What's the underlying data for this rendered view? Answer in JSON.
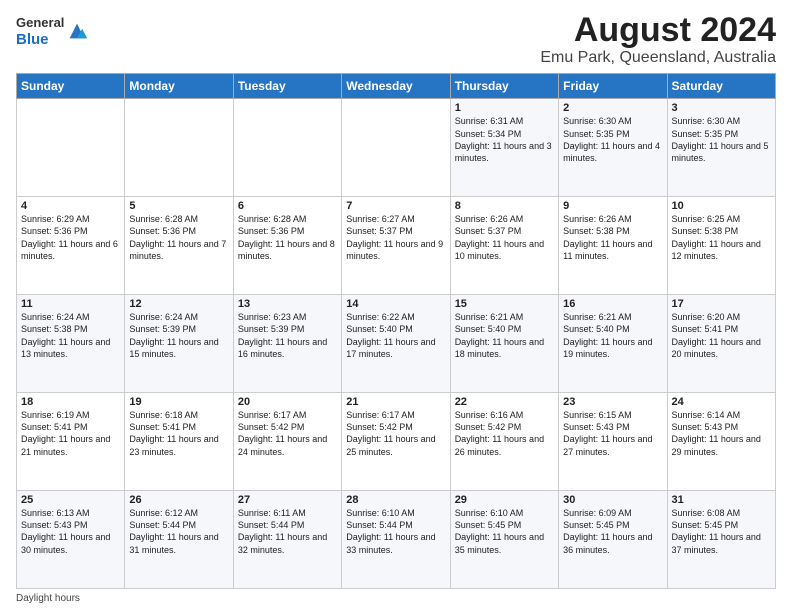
{
  "logo": {
    "general": "General",
    "blue": "Blue"
  },
  "title": "August 2024",
  "subtitle": "Emu Park, Queensland, Australia",
  "header_days": [
    "Sunday",
    "Monday",
    "Tuesday",
    "Wednesday",
    "Thursday",
    "Friday",
    "Saturday"
  ],
  "weeks": [
    [
      {
        "day": "",
        "info": ""
      },
      {
        "day": "",
        "info": ""
      },
      {
        "day": "",
        "info": ""
      },
      {
        "day": "",
        "info": ""
      },
      {
        "day": "1",
        "info": "Sunrise: 6:31 AM\nSunset: 5:34 PM\nDaylight: 11 hours and 3 minutes."
      },
      {
        "day": "2",
        "info": "Sunrise: 6:30 AM\nSunset: 5:35 PM\nDaylight: 11 hours and 4 minutes."
      },
      {
        "day": "3",
        "info": "Sunrise: 6:30 AM\nSunset: 5:35 PM\nDaylight: 11 hours and 5 minutes."
      }
    ],
    [
      {
        "day": "4",
        "info": "Sunrise: 6:29 AM\nSunset: 5:36 PM\nDaylight: 11 hours and 6 minutes."
      },
      {
        "day": "5",
        "info": "Sunrise: 6:28 AM\nSunset: 5:36 PM\nDaylight: 11 hours and 7 minutes."
      },
      {
        "day": "6",
        "info": "Sunrise: 6:28 AM\nSunset: 5:36 PM\nDaylight: 11 hours and 8 minutes."
      },
      {
        "day": "7",
        "info": "Sunrise: 6:27 AM\nSunset: 5:37 PM\nDaylight: 11 hours and 9 minutes."
      },
      {
        "day": "8",
        "info": "Sunrise: 6:26 AM\nSunset: 5:37 PM\nDaylight: 11 hours and 10 minutes."
      },
      {
        "day": "9",
        "info": "Sunrise: 6:26 AM\nSunset: 5:38 PM\nDaylight: 11 hours and 11 minutes."
      },
      {
        "day": "10",
        "info": "Sunrise: 6:25 AM\nSunset: 5:38 PM\nDaylight: 11 hours and 12 minutes."
      }
    ],
    [
      {
        "day": "11",
        "info": "Sunrise: 6:24 AM\nSunset: 5:38 PM\nDaylight: 11 hours and 13 minutes."
      },
      {
        "day": "12",
        "info": "Sunrise: 6:24 AM\nSunset: 5:39 PM\nDaylight: 11 hours and 15 minutes."
      },
      {
        "day": "13",
        "info": "Sunrise: 6:23 AM\nSunset: 5:39 PM\nDaylight: 11 hours and 16 minutes."
      },
      {
        "day": "14",
        "info": "Sunrise: 6:22 AM\nSunset: 5:40 PM\nDaylight: 11 hours and 17 minutes."
      },
      {
        "day": "15",
        "info": "Sunrise: 6:21 AM\nSunset: 5:40 PM\nDaylight: 11 hours and 18 minutes."
      },
      {
        "day": "16",
        "info": "Sunrise: 6:21 AM\nSunset: 5:40 PM\nDaylight: 11 hours and 19 minutes."
      },
      {
        "day": "17",
        "info": "Sunrise: 6:20 AM\nSunset: 5:41 PM\nDaylight: 11 hours and 20 minutes."
      }
    ],
    [
      {
        "day": "18",
        "info": "Sunrise: 6:19 AM\nSunset: 5:41 PM\nDaylight: 11 hours and 21 minutes."
      },
      {
        "day": "19",
        "info": "Sunrise: 6:18 AM\nSunset: 5:41 PM\nDaylight: 11 hours and 23 minutes."
      },
      {
        "day": "20",
        "info": "Sunrise: 6:17 AM\nSunset: 5:42 PM\nDaylight: 11 hours and 24 minutes."
      },
      {
        "day": "21",
        "info": "Sunrise: 6:17 AM\nSunset: 5:42 PM\nDaylight: 11 hours and 25 minutes."
      },
      {
        "day": "22",
        "info": "Sunrise: 6:16 AM\nSunset: 5:42 PM\nDaylight: 11 hours and 26 minutes."
      },
      {
        "day": "23",
        "info": "Sunrise: 6:15 AM\nSunset: 5:43 PM\nDaylight: 11 hours and 27 minutes."
      },
      {
        "day": "24",
        "info": "Sunrise: 6:14 AM\nSunset: 5:43 PM\nDaylight: 11 hours and 29 minutes."
      }
    ],
    [
      {
        "day": "25",
        "info": "Sunrise: 6:13 AM\nSunset: 5:43 PM\nDaylight: 11 hours and 30 minutes."
      },
      {
        "day": "26",
        "info": "Sunrise: 6:12 AM\nSunset: 5:44 PM\nDaylight: 11 hours and 31 minutes."
      },
      {
        "day": "27",
        "info": "Sunrise: 6:11 AM\nSunset: 5:44 PM\nDaylight: 11 hours and 32 minutes."
      },
      {
        "day": "28",
        "info": "Sunrise: 6:10 AM\nSunset: 5:44 PM\nDaylight: 11 hours and 33 minutes."
      },
      {
        "day": "29",
        "info": "Sunrise: 6:10 AM\nSunset: 5:45 PM\nDaylight: 11 hours and 35 minutes."
      },
      {
        "day": "30",
        "info": "Sunrise: 6:09 AM\nSunset: 5:45 PM\nDaylight: 11 hours and 36 minutes."
      },
      {
        "day": "31",
        "info": "Sunrise: 6:08 AM\nSunset: 5:45 PM\nDaylight: 11 hours and 37 minutes."
      }
    ]
  ],
  "footer": "Daylight hours"
}
